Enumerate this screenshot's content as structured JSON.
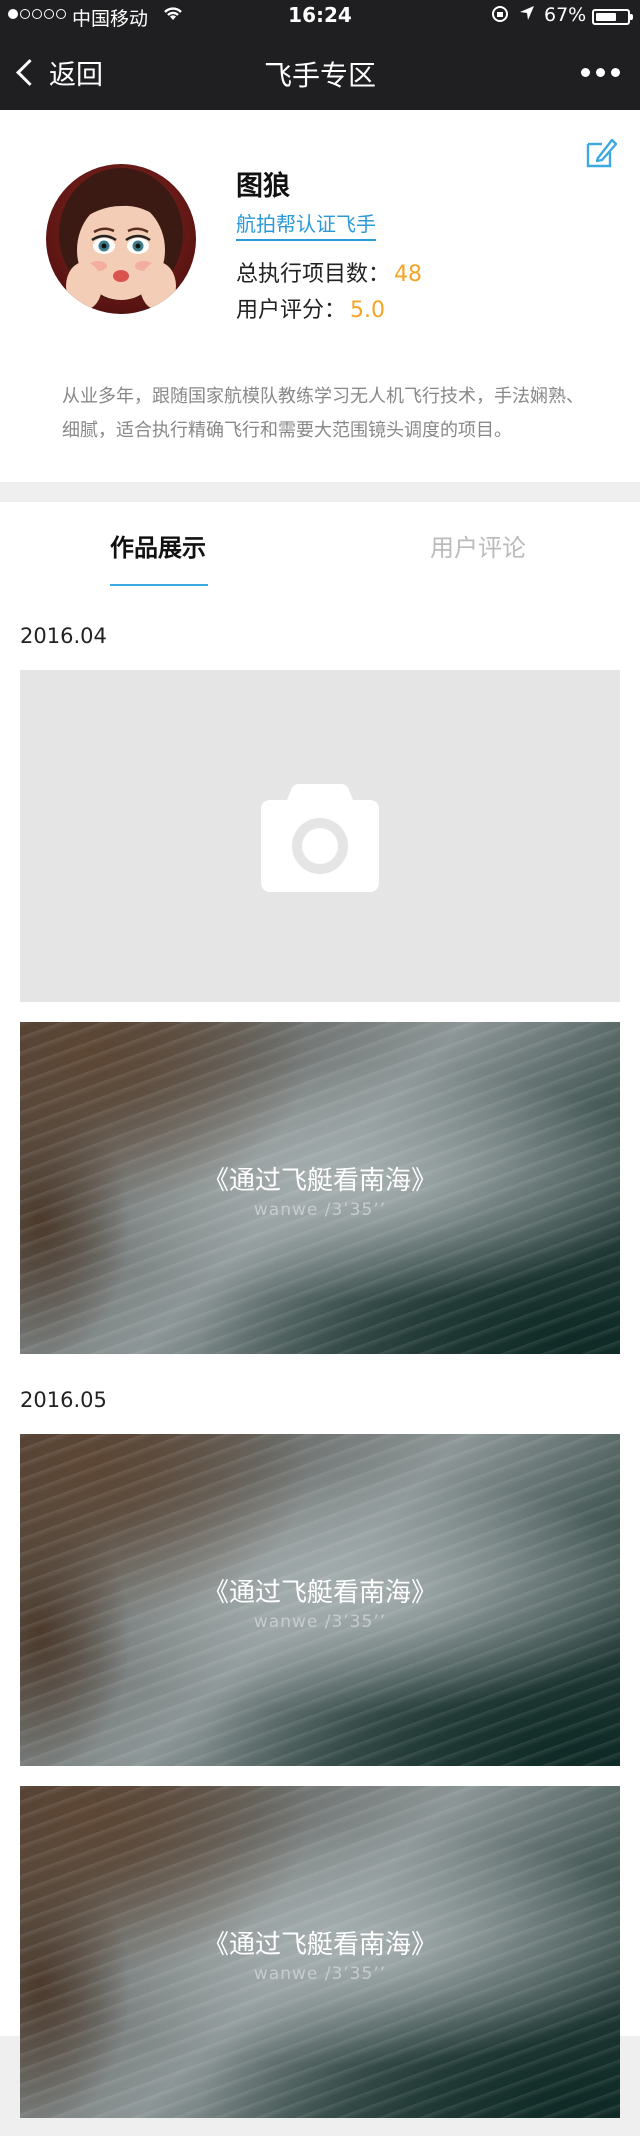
{
  "status_bar": {
    "carrier": "中国移动",
    "time": "16:24",
    "battery": "67%",
    "battery_level": 0.67
  },
  "nav": {
    "back_label": "返回",
    "title": "飞手专区"
  },
  "profile": {
    "name": "图狼",
    "certification": "航拍帮认证飞手",
    "projects_label": "总执行项目数：",
    "projects_value": "48",
    "rating_label": "用户评分：",
    "rating_value": "5.0",
    "description": "从业多年，跟随国家航模队教练学习无人机飞行技术，手法娴熟、细腻，适合执行精确飞行和需要大范围镜头调度的项目。"
  },
  "tabs": {
    "works": "作品展示",
    "reviews": "用户评论"
  },
  "works": [
    {
      "date": "2016.04",
      "video": {
        "title": "《通过飞艇看南海》",
        "meta": "wanwe /3’35’’"
      }
    },
    {
      "date": "2016.05",
      "videos": [
        {
          "title": "《通过飞艇看南海》",
          "meta": "wanwe /3’35’’"
        },
        {
          "title": "《通过飞艇看南海》",
          "meta": "wanwe /3’35’’"
        }
      ]
    }
  ],
  "colors": {
    "accent": "#3ea8e0",
    "highlight": "#f5a425",
    "nav_bg": "#1f1f21"
  }
}
